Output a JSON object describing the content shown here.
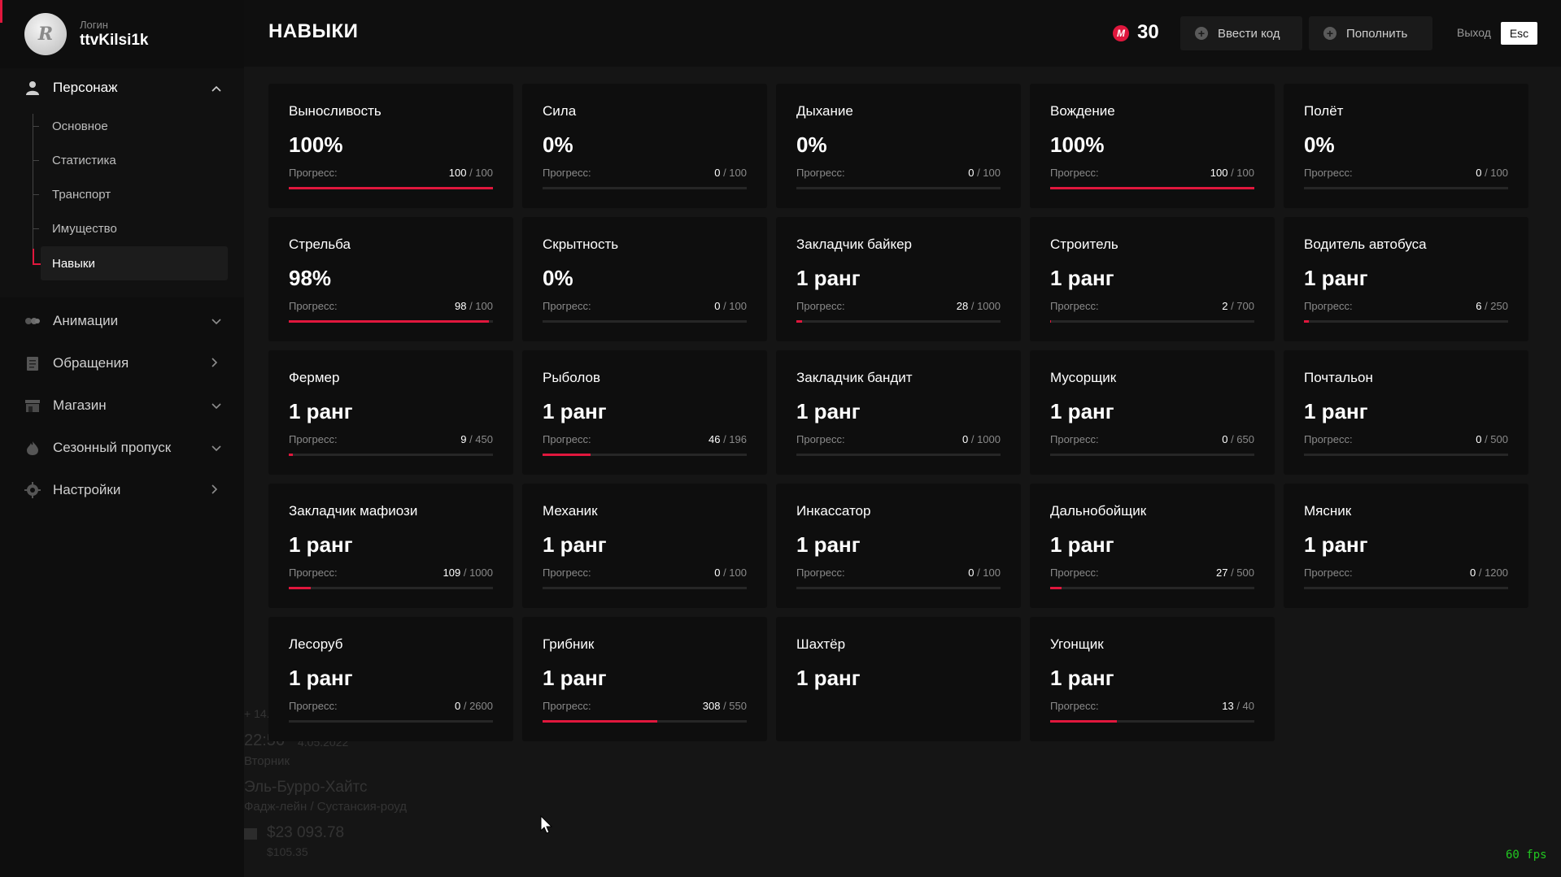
{
  "sidebar": {
    "login_label": "Логин",
    "username": "ttvKilsi1k",
    "avatar_text": "R",
    "sections": [
      {
        "label": "Персонаж",
        "icon": "person-icon",
        "chevron": "chevron-up-icon"
      },
      {
        "label": "Анимации",
        "icon": "animation-icon",
        "chevron": "chevron-down-icon"
      },
      {
        "label": "Обращения",
        "icon": "document-icon",
        "chevron": "chevron-right-icon"
      },
      {
        "label": "Магазин",
        "icon": "store-icon",
        "chevron": "chevron-down-icon"
      },
      {
        "label": "Сезонный пропуск",
        "icon": "flame-icon",
        "chevron": "chevron-down-icon"
      },
      {
        "label": "Настройки",
        "icon": "gear-icon",
        "chevron": "chevron-right-icon"
      }
    ],
    "subitems": [
      "Основное",
      "Статистика",
      "Транспорт",
      "Имущество",
      "Навыки"
    ],
    "active_subitem": "Навыки"
  },
  "header": {
    "title": "НАВЫКИ",
    "balance": "30",
    "coin_symbol": "M",
    "redeem_label": "Ввести код",
    "topup_label": "Пополнить",
    "exit_label": "Выход",
    "exit_key": "Esc"
  },
  "hud": {
    "top": "+ 14.",
    "time": "22:56",
    "date": "4.05.2022",
    "day": "Вторник",
    "location": "Эль-Бурро-Хайтс",
    "street": "Фадж-лейн / Сустансия-роуд",
    "cash": "$23 093.78",
    "bank": "$105.35"
  },
  "fps": "60 fps",
  "progress_label": "Прогресс:",
  "accent_color": "#e0173d",
  "skills": [
    {
      "name": "Выносливость",
      "value": "100%",
      "current": "100",
      "max": "/ 100",
      "fraction": 1.0
    },
    {
      "name": "Сила",
      "value": "0%",
      "current": "0",
      "max": "/ 100",
      "fraction": 0
    },
    {
      "name": "Дыхание",
      "value": "0%",
      "current": "0",
      "max": "/ 100",
      "fraction": 0
    },
    {
      "name": "Вождение",
      "value": "100%",
      "current": "100",
      "max": "/ 100",
      "fraction": 1.0
    },
    {
      "name": "Полёт",
      "value": "0%",
      "current": "0",
      "max": "/ 100",
      "fraction": 0
    },
    {
      "name": "Стрельба",
      "value": "98%",
      "current": "98",
      "max": "/ 100",
      "fraction": 0.98
    },
    {
      "name": "Скрытность",
      "value": "0%",
      "current": "0",
      "max": "/ 100",
      "fraction": 0
    },
    {
      "name": "Закладчик байкер",
      "value": "1 ранг",
      "current": "28",
      "max": "/ 1000",
      "fraction": 0.028
    },
    {
      "name": "Строитель",
      "value": "1 ранг",
      "current": "2",
      "max": "/ 700",
      "fraction": 0.003
    },
    {
      "name": "Водитель автобуса",
      "value": "1 ранг",
      "current": "6",
      "max": "/ 250",
      "fraction": 0.024
    },
    {
      "name": "Фермер",
      "value": "1 ранг",
      "current": "9",
      "max": "/ 450",
      "fraction": 0.02
    },
    {
      "name": "Рыболов",
      "value": "1 ранг",
      "current": "46",
      "max": "/ 196",
      "fraction": 0.235
    },
    {
      "name": "Закладчик бандит",
      "value": "1 ранг",
      "current": "0",
      "max": "/ 1000",
      "fraction": 0
    },
    {
      "name": "Мусорщик",
      "value": "1 ранг",
      "current": "0",
      "max": "/ 650",
      "fraction": 0
    },
    {
      "name": "Почтальон",
      "value": "1 ранг",
      "current": "0",
      "max": "/ 500",
      "fraction": 0
    },
    {
      "name": "Закладчик мафиози",
      "value": "1 ранг",
      "current": "109",
      "max": "/ 1000",
      "fraction": 0.109
    },
    {
      "name": "Механик",
      "value": "1 ранг",
      "current": "0",
      "max": "/ 100",
      "fraction": 0
    },
    {
      "name": "Инкассатор",
      "value": "1 ранг",
      "current": "0",
      "max": "/ 100",
      "fraction": 0
    },
    {
      "name": "Дальнобойщик",
      "value": "1 ранг",
      "current": "27",
      "max": "/ 500",
      "fraction": 0.054
    },
    {
      "name": "Мясник",
      "value": "1 ранг",
      "current": "0",
      "max": "/ 1200",
      "fraction": 0
    },
    {
      "name": "Лесоруб",
      "value": "1 ранг",
      "current": "0",
      "max": "/ 2600",
      "fraction": 0
    },
    {
      "name": "Грибник",
      "value": "1 ранг",
      "current": "308",
      "max": "/ 550",
      "fraction": 0.56
    },
    {
      "name": "Шахтёр",
      "value": "1 ранг",
      "current": "",
      "max": "",
      "fraction": null
    },
    {
      "name": "Угонщик",
      "value": "1 ранг",
      "current": "13",
      "max": "/ 40",
      "fraction": 0.325
    }
  ]
}
